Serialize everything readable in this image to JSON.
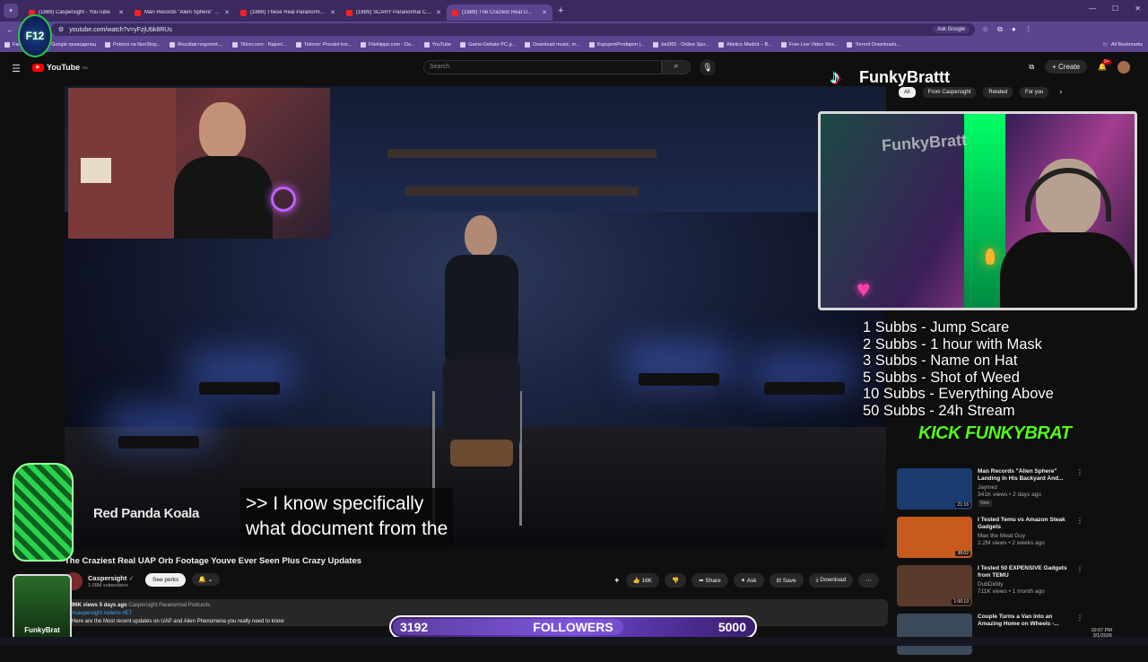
{
  "browser": {
    "tabs": [
      {
        "label": "(1889) Caspersight - YouTube",
        "active": false
      },
      {
        "label": "Man Records \"Alien Sphere\" La...",
        "active": false
      },
      {
        "label": "(1889) These Real Paranormal E...",
        "active": false
      },
      {
        "label": "(1889) SCARY Paranormal Clips...",
        "active": false
      },
      {
        "label": "(1889) The Craziest Real U...",
        "active": true
      }
    ],
    "url": "youtube.com/watch?v=yFzjUbk8RUs",
    "ask_google": "Ask Google",
    "bookmarks": [
      "Facebook",
      "Google преводилац",
      "Pokloni na NonStop...",
      "Rezultati nogomet,...",
      "Titlovi.com - Najveć...",
      "Telenor: Privatni kor...",
      "FileHippo.com - Do...",
      "YouTube",
      "Game-Debate PC g...",
      "Download music, m...",
      "KupujemProdajem |...",
      "bet365 - Online Spo...",
      "Atletico Madrid – B...",
      "Free Live Video Stre...",
      "Torrent Downloads..."
    ],
    "all_bookmarks": "All Bookmarks"
  },
  "youtube": {
    "logo": "YouTube",
    "logo_region": "RS",
    "search_placeholder": "Search",
    "create_label": "Create",
    "notif_count": "9+",
    "chips": [
      "All",
      "From Caspersight",
      "Related",
      "For you"
    ]
  },
  "overlay": {
    "tiktok_name": "FunkyBrattt",
    "webcam_logo": "FunkyBratt",
    "kick_text": "KICK FUNKYBRAT",
    "badge_name": "FunkyBrat",
    "f12_text": "F12",
    "rules": [
      "1 Subbs - Jump Scare",
      "2 Subbs - 1 hour with Mask",
      "3 Subbs - Name on Hat",
      "5 Subbs - Shot of Weed",
      "10 Subbs - Everything Above",
      "50 Subbs - 24h Stream"
    ],
    "followers_current": "3192",
    "followers_label": "FOLLOWERS",
    "followers_goal": "5000",
    "followers_progress": 0.6384
  },
  "video": {
    "caption_line1": ">> I know specifically",
    "caption_line2": "what document from the",
    "watermark": "Red Panda Koala",
    "title": "The Craziest Real UAP Orb Footage Youve Ever Seen Plus Crazy Updates",
    "channel": "Caspersight",
    "subscribers": "1.09M subscribers",
    "perks_label": "See perks",
    "likes": "16K",
    "share_label": "Share",
    "ask_label": "Ask",
    "save_label": "Save",
    "download_label": "Download",
    "views": "96K views",
    "age": "5 days ago",
    "playlist": "Caspersight Paranormal Podcasts",
    "tags": "#caspersight #aliens #ET",
    "desc_text": "Here are the Most recent updates on UAP and Alien Phenomena you really need to know"
  },
  "sidebar": [
    {
      "title": "Man Records \"Alien Sphere\" Landing In His Backyard And...",
      "channel": "Jaymez",
      "meta": "341K views • 2 days ago",
      "badge": "New",
      "duration": "21:16",
      "thumb_color": "#1b3c6e"
    },
    {
      "title": "I Tested Temu vs Amazon Steak Gadgets",
      "channel": "Max the Meat Guy",
      "meta": "2.2M views • 2 weeks ago",
      "badge": "",
      "duration": "38:02",
      "thumb_color": "#c95a1e"
    },
    {
      "title": "I Tested 50 EXPENSIVE Gadgets from TEMU",
      "channel": "DubDiddy",
      "meta": "711K views • 1 month ago",
      "badge": "",
      "duration": "1:06:19",
      "thumb_color": "#5a3a2a"
    },
    {
      "title": "Couple Turns a Van into an Amazing Home on Wheels -...",
      "channel": "",
      "meta": "",
      "badge": "",
      "duration": "",
      "thumb_color": "#3a4a5a"
    }
  ],
  "taskbar": {
    "time": "10:07 PM",
    "date": "3/1/2026"
  }
}
